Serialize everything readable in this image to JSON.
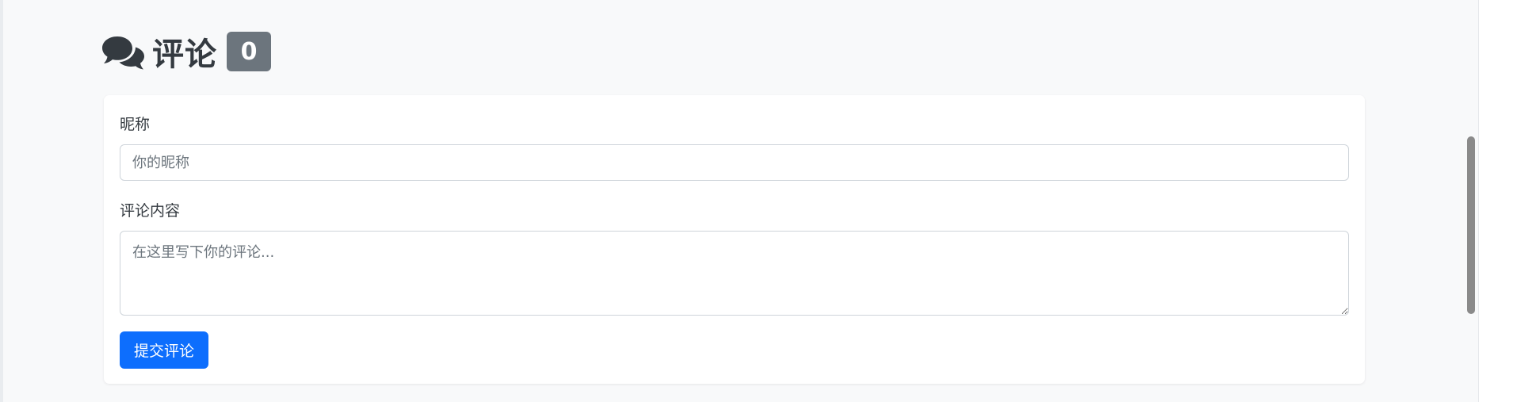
{
  "comments": {
    "icon": "comments-icon",
    "title": "评论",
    "count": "0"
  },
  "form": {
    "nickname_label": "昵称",
    "nickname_placeholder": "你的昵称",
    "nickname_value": "",
    "content_label": "评论内容",
    "content_placeholder": "在这里写下你的评论...",
    "content_value": "",
    "submit_label": "提交评论"
  },
  "colors": {
    "primary": "#0d6efd",
    "badge": "#6c757d",
    "title": "#343a40",
    "page_bg": "#f8f9fa"
  }
}
